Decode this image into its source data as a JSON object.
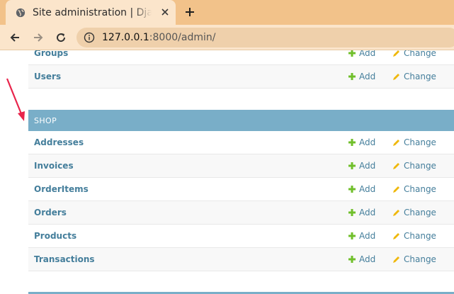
{
  "browser": {
    "tab_title": "Site administration | Django site admin",
    "url_host": "127.0.0.1",
    "url_rest": ":8000/admin/"
  },
  "auth_section": {
    "rows": [
      {
        "name": "Groups",
        "add": "Add",
        "change": "Change"
      },
      {
        "name": "Users",
        "add": "Add",
        "change": "Change"
      }
    ]
  },
  "shop_section": {
    "caption": "SHOP",
    "rows": [
      {
        "name": "Addresses",
        "add": "Add",
        "change": "Change"
      },
      {
        "name": "Invoices",
        "add": "Add",
        "change": "Change"
      },
      {
        "name": "OrderItems",
        "add": "Add",
        "change": "Change"
      },
      {
        "name": "Orders",
        "add": "Add",
        "change": "Change"
      },
      {
        "name": "Products",
        "add": "Add",
        "change": "Change"
      },
      {
        "name": "Transactions",
        "add": "Add",
        "change": "Change"
      }
    ]
  },
  "colors": {
    "link": "#447e9b",
    "caption_bg": "#79aec8",
    "add_icon": "#70bf2b",
    "change_icon": "#efb80b",
    "annotation_arrow": "#e8254c"
  },
  "icons": [
    "globe-icon",
    "close-icon",
    "plus-icon",
    "back-arrow-icon",
    "forward-arrow-icon",
    "reload-icon",
    "info-icon",
    "add-icon",
    "pencil-icon"
  ]
}
